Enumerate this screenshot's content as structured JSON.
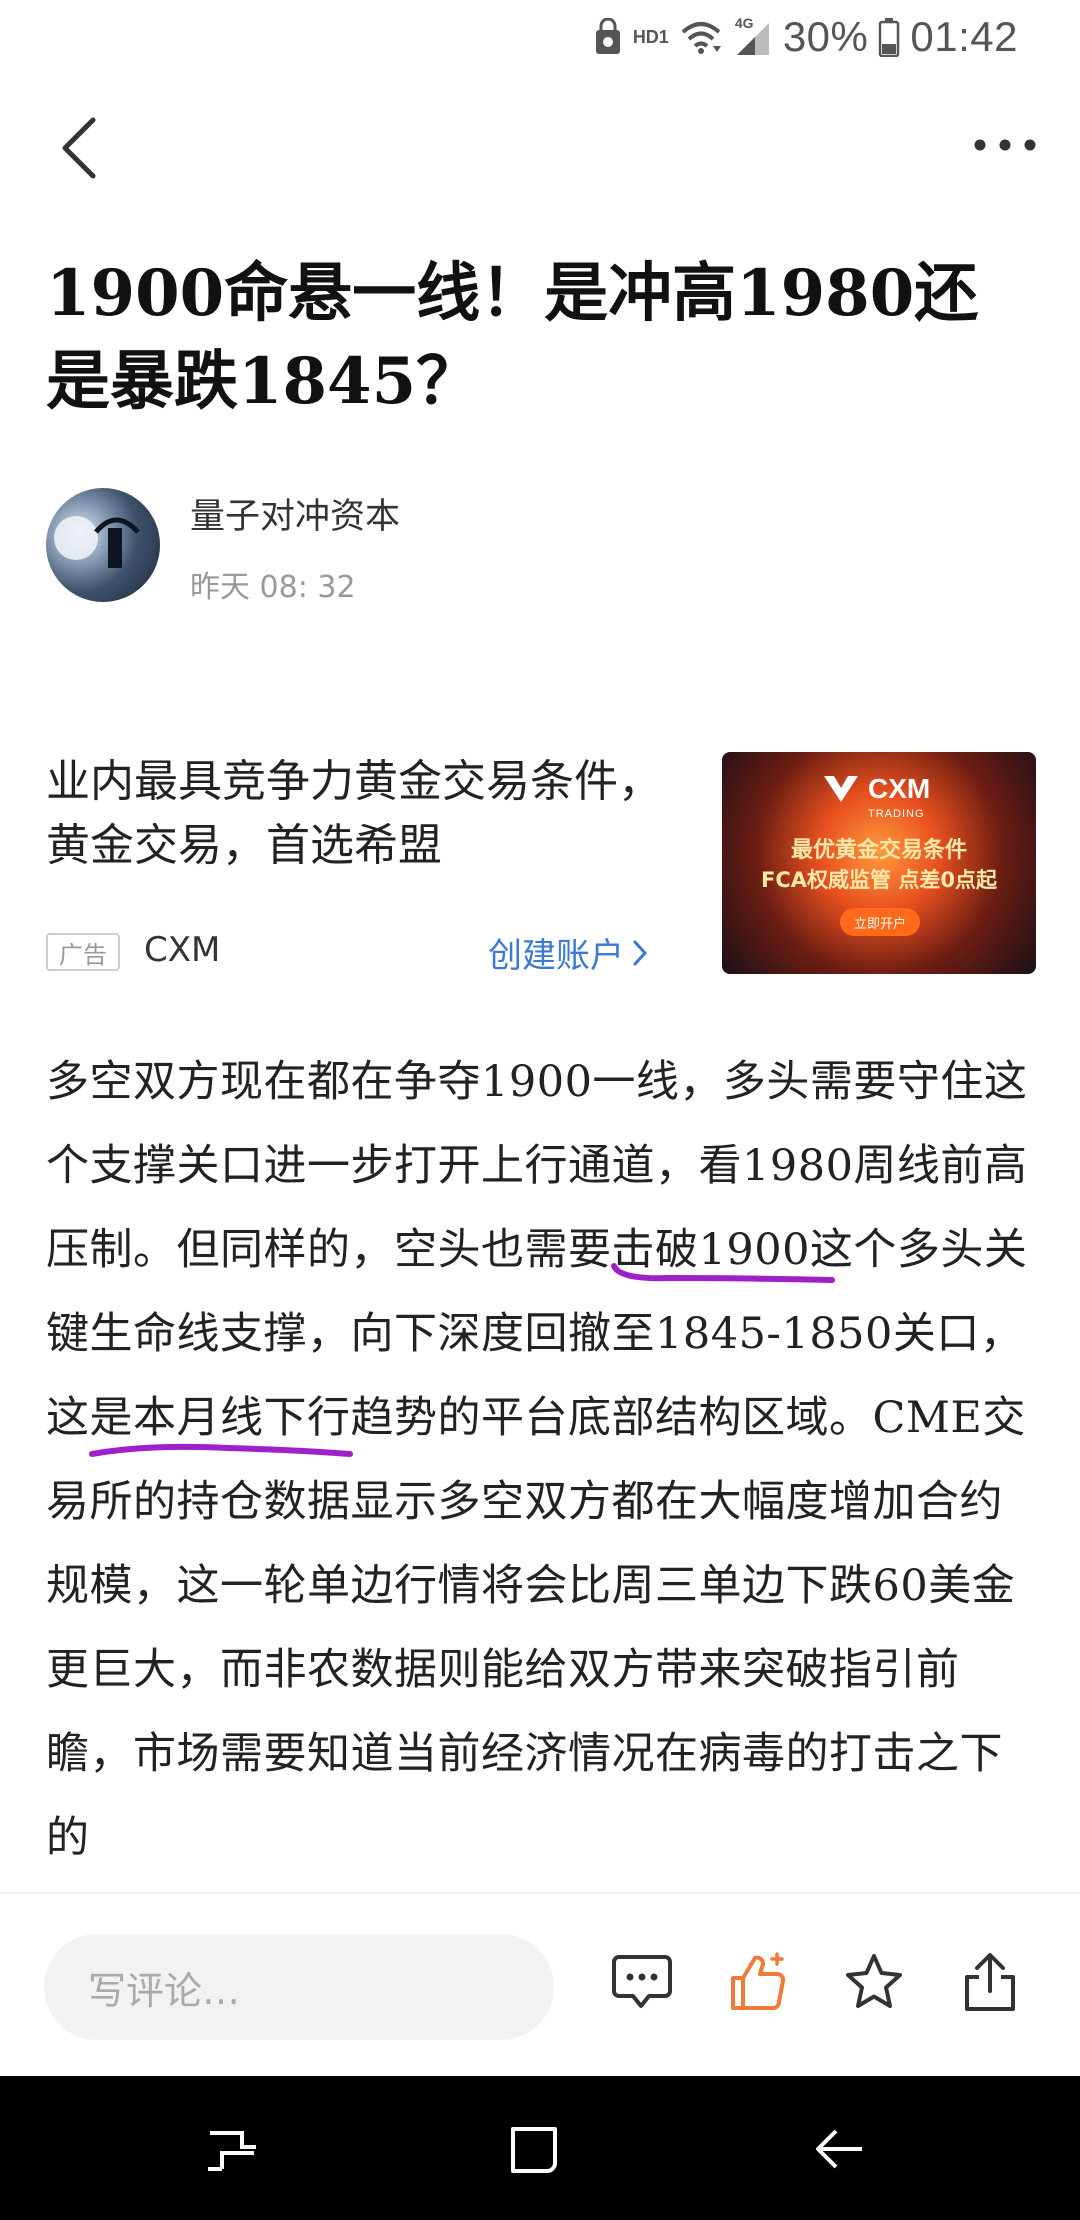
{
  "status_bar": {
    "hd_label": "HD1",
    "network_label": "4G",
    "battery": "30%",
    "time": "01:42"
  },
  "nav": {
    "back_icon": "chevron-left-icon",
    "more_icon": "more-horizontal-icon"
  },
  "article": {
    "title": "1900命悬一线！是冲高1980还是暴跌1845？",
    "author_name": "量子对冲资本",
    "publish_time": "昨天 08: 32",
    "body": "多空双方现在都在争夺1900一线，多头需要守住这个支撑关口进一步打开上行通道，看1980周线前高压制。但同样的，空头也需要击破1900这个多头关键生命线支撑，向下深度回撤至1845-1850关口，这是本月线下行趋势的平台底部结构区域。CME交易所的持仓数据显示多空双方都在大幅度增加合约规模，这一轮单边行情将会比周三单边下跌60美金更巨大，而非农数据则能给双方带来突破指引前瞻，市场需要知道当前经济情况在病毒的打击之下的",
    "annotation_color": "#a020c8"
  },
  "ad": {
    "headline": "业内最具竞争力黄金交易条件，黄金交易，首选希盟",
    "tag": "广告",
    "brand": "CXM",
    "cta": "创建账户",
    "image": {
      "logo": "CXM",
      "logo_sub": "TRADING",
      "line1": "最优黄金交易条件",
      "line2": "FCA权威监管 点差0点起",
      "button": "立即开户"
    }
  },
  "action_bar": {
    "comment_placeholder": "写评论…",
    "icons": [
      "comment-icon",
      "like-icon",
      "favorite-star-icon",
      "share-icon"
    ],
    "like_color": "#f07a3a"
  },
  "system_nav": {
    "icons": [
      "recents-icon",
      "home-icon",
      "back-nav-icon"
    ]
  }
}
